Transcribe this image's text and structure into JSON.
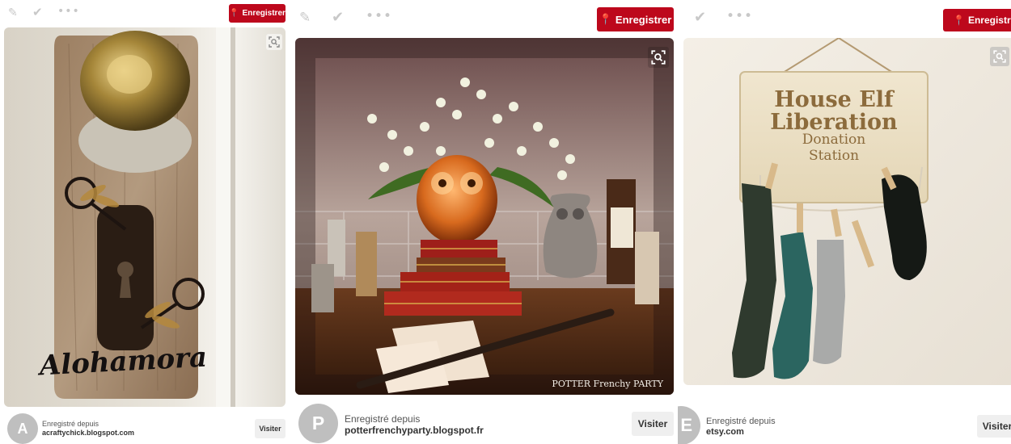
{
  "pins": [
    {
      "save_label": "Enregistrer",
      "saved_from_label": "Enregistré depuis",
      "source_domain": "acraftychick.blogspot.com",
      "avatar_letter": "A",
      "visit_label": "Visiter",
      "image_text": "Alohamora"
    },
    {
      "save_label": "Enregistrer",
      "saved_from_label": "Enregistré depuis",
      "source_domain": "potterfrenchyparty.blogspot.fr",
      "avatar_letter": "P",
      "visit_label": "Visiter",
      "image_watermark": "POTTER Frenchy PARTY"
    },
    {
      "save_label": "Enregistrer",
      "saved_from_label": "Enregistré depuis",
      "source_domain": "etsy.com",
      "avatar_letter": "E",
      "visit_label": "Visiter",
      "image_text_lines": [
        "House Elf",
        "Liberation",
        "Donation",
        "Station"
      ]
    }
  ],
  "icons": {
    "edit": "pencil-icon",
    "done": "checkmark-icon",
    "more": "more-icon",
    "pin": "pushpin-icon",
    "zoom": "visual-search-icon"
  },
  "colors": {
    "save_button": "#bd081c",
    "icon_gray": "#c8c8c8",
    "visit_button": "#efefef"
  }
}
